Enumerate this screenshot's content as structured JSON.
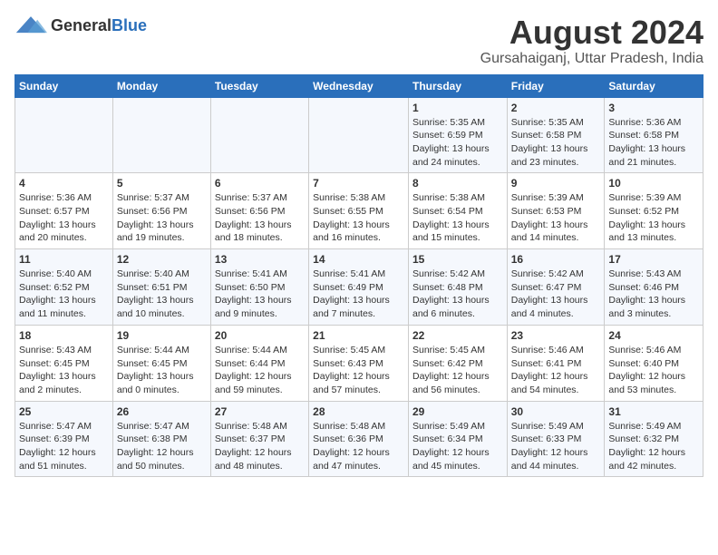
{
  "logo": {
    "general": "General",
    "blue": "Blue"
  },
  "title": "August 2024",
  "subtitle": "Gursahaiganj, Uttar Pradesh, India",
  "days_of_week": [
    "Sunday",
    "Monday",
    "Tuesday",
    "Wednesday",
    "Thursday",
    "Friday",
    "Saturday"
  ],
  "weeks": [
    [
      {
        "num": "",
        "info": ""
      },
      {
        "num": "",
        "info": ""
      },
      {
        "num": "",
        "info": ""
      },
      {
        "num": "",
        "info": ""
      },
      {
        "num": "1",
        "info": "Sunrise: 5:35 AM\nSunset: 6:59 PM\nDaylight: 13 hours and 24 minutes."
      },
      {
        "num": "2",
        "info": "Sunrise: 5:35 AM\nSunset: 6:58 PM\nDaylight: 13 hours and 23 minutes."
      },
      {
        "num": "3",
        "info": "Sunrise: 5:36 AM\nSunset: 6:58 PM\nDaylight: 13 hours and 21 minutes."
      }
    ],
    [
      {
        "num": "4",
        "info": "Sunrise: 5:36 AM\nSunset: 6:57 PM\nDaylight: 13 hours and 20 minutes."
      },
      {
        "num": "5",
        "info": "Sunrise: 5:37 AM\nSunset: 6:56 PM\nDaylight: 13 hours and 19 minutes."
      },
      {
        "num": "6",
        "info": "Sunrise: 5:37 AM\nSunset: 6:56 PM\nDaylight: 13 hours and 18 minutes."
      },
      {
        "num": "7",
        "info": "Sunrise: 5:38 AM\nSunset: 6:55 PM\nDaylight: 13 hours and 16 minutes."
      },
      {
        "num": "8",
        "info": "Sunrise: 5:38 AM\nSunset: 6:54 PM\nDaylight: 13 hours and 15 minutes."
      },
      {
        "num": "9",
        "info": "Sunrise: 5:39 AM\nSunset: 6:53 PM\nDaylight: 13 hours and 14 minutes."
      },
      {
        "num": "10",
        "info": "Sunrise: 5:39 AM\nSunset: 6:52 PM\nDaylight: 13 hours and 13 minutes."
      }
    ],
    [
      {
        "num": "11",
        "info": "Sunrise: 5:40 AM\nSunset: 6:52 PM\nDaylight: 13 hours and 11 minutes."
      },
      {
        "num": "12",
        "info": "Sunrise: 5:40 AM\nSunset: 6:51 PM\nDaylight: 13 hours and 10 minutes."
      },
      {
        "num": "13",
        "info": "Sunrise: 5:41 AM\nSunset: 6:50 PM\nDaylight: 13 hours and 9 minutes."
      },
      {
        "num": "14",
        "info": "Sunrise: 5:41 AM\nSunset: 6:49 PM\nDaylight: 13 hours and 7 minutes."
      },
      {
        "num": "15",
        "info": "Sunrise: 5:42 AM\nSunset: 6:48 PM\nDaylight: 13 hours and 6 minutes."
      },
      {
        "num": "16",
        "info": "Sunrise: 5:42 AM\nSunset: 6:47 PM\nDaylight: 13 hours and 4 minutes."
      },
      {
        "num": "17",
        "info": "Sunrise: 5:43 AM\nSunset: 6:46 PM\nDaylight: 13 hours and 3 minutes."
      }
    ],
    [
      {
        "num": "18",
        "info": "Sunrise: 5:43 AM\nSunset: 6:45 PM\nDaylight: 13 hours and 2 minutes."
      },
      {
        "num": "19",
        "info": "Sunrise: 5:44 AM\nSunset: 6:45 PM\nDaylight: 13 hours and 0 minutes."
      },
      {
        "num": "20",
        "info": "Sunrise: 5:44 AM\nSunset: 6:44 PM\nDaylight: 12 hours and 59 minutes."
      },
      {
        "num": "21",
        "info": "Sunrise: 5:45 AM\nSunset: 6:43 PM\nDaylight: 12 hours and 57 minutes."
      },
      {
        "num": "22",
        "info": "Sunrise: 5:45 AM\nSunset: 6:42 PM\nDaylight: 12 hours and 56 minutes."
      },
      {
        "num": "23",
        "info": "Sunrise: 5:46 AM\nSunset: 6:41 PM\nDaylight: 12 hours and 54 minutes."
      },
      {
        "num": "24",
        "info": "Sunrise: 5:46 AM\nSunset: 6:40 PM\nDaylight: 12 hours and 53 minutes."
      }
    ],
    [
      {
        "num": "25",
        "info": "Sunrise: 5:47 AM\nSunset: 6:39 PM\nDaylight: 12 hours and 51 minutes."
      },
      {
        "num": "26",
        "info": "Sunrise: 5:47 AM\nSunset: 6:38 PM\nDaylight: 12 hours and 50 minutes."
      },
      {
        "num": "27",
        "info": "Sunrise: 5:48 AM\nSunset: 6:37 PM\nDaylight: 12 hours and 48 minutes."
      },
      {
        "num": "28",
        "info": "Sunrise: 5:48 AM\nSunset: 6:36 PM\nDaylight: 12 hours and 47 minutes."
      },
      {
        "num": "29",
        "info": "Sunrise: 5:49 AM\nSunset: 6:34 PM\nDaylight: 12 hours and 45 minutes."
      },
      {
        "num": "30",
        "info": "Sunrise: 5:49 AM\nSunset: 6:33 PM\nDaylight: 12 hours and 44 minutes."
      },
      {
        "num": "31",
        "info": "Sunrise: 5:49 AM\nSunset: 6:32 PM\nDaylight: 12 hours and 42 minutes."
      }
    ]
  ]
}
